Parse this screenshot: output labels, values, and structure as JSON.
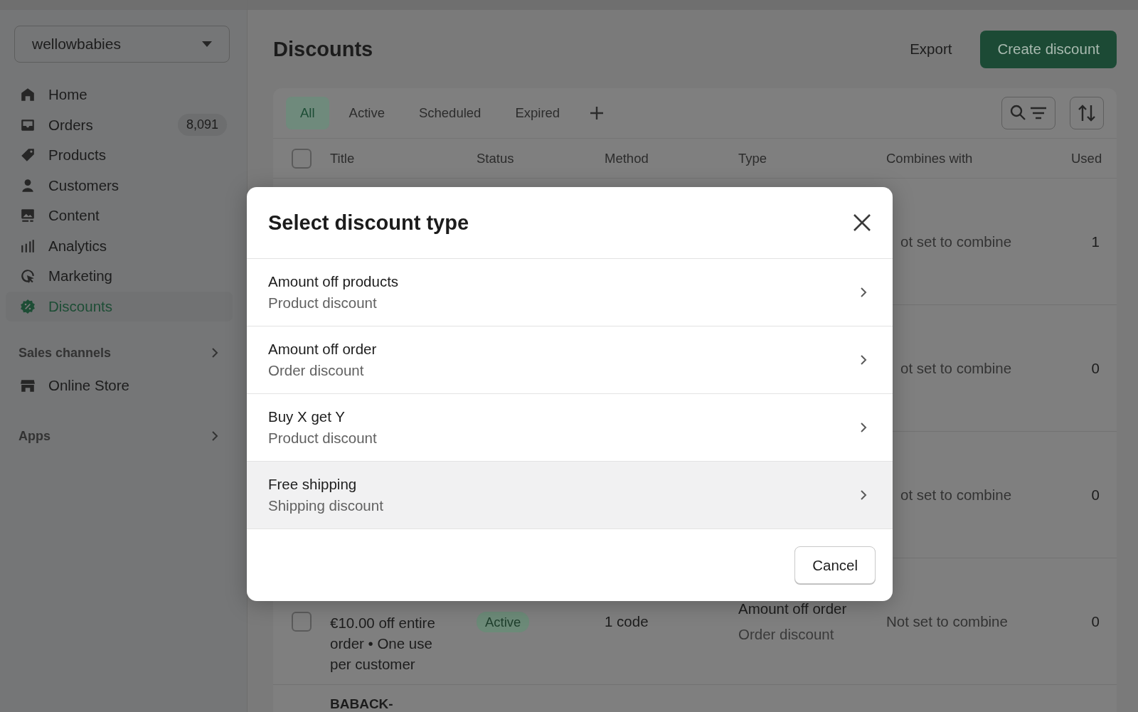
{
  "store_selector": {
    "value": "wellowbabies"
  },
  "sidebar": {
    "items": [
      {
        "label": "Home",
        "selected": false
      },
      {
        "label": "Orders",
        "badge": "8,091",
        "selected": false
      },
      {
        "label": "Products",
        "selected": false
      },
      {
        "label": "Customers",
        "selected": false
      },
      {
        "label": "Content",
        "selected": false
      },
      {
        "label": "Analytics",
        "selected": false
      },
      {
        "label": "Marketing",
        "selected": false
      },
      {
        "label": "Discounts",
        "selected": true
      }
    ],
    "sections": [
      {
        "heading": "Sales channels",
        "items": [
          {
            "label": "Online Store",
            "selected": false
          }
        ]
      },
      {
        "heading": "Apps"
      }
    ]
  },
  "page": {
    "title": "Discounts",
    "actions": [
      {
        "label": "Export",
        "kind": "plain"
      },
      {
        "label": "Create discount",
        "kind": "primary"
      }
    ]
  },
  "tabs": [
    {
      "label": "All",
      "selected": true
    },
    {
      "label": "Active",
      "selected": false
    },
    {
      "label": "Scheduled",
      "selected": false
    },
    {
      "label": "Expired",
      "selected": false
    }
  ],
  "table": {
    "select_all": {
      "checked": false
    },
    "columns": [
      "Title",
      "Status",
      "Method",
      "Type",
      "Combines with",
      "Used"
    ],
    "rows": [
      {
        "combines_with": "ot set to combine",
        "used": "1"
      },
      {
        "combines_with": "ot set to combine",
        "used": "0"
      },
      {
        "combines_with": "ot set to combine",
        "used": "0"
      },
      {
        "checked": false,
        "title": "€10.00 off entire order • One use per customer",
        "status": "Active",
        "method": "1 code",
        "type": "Amount off order",
        "type_detail": "Order discount",
        "combines_with": "Not set to combine",
        "used": "0"
      },
      {
        "title": "BABACK-"
      }
    ]
  },
  "modal": {
    "title": "Select discount type",
    "options": [
      {
        "title": "Amount off products",
        "subtitle": "Product discount",
        "selected": false
      },
      {
        "title": "Amount off order",
        "subtitle": "Order discount",
        "selected": false
      },
      {
        "title": "Buy X get Y",
        "subtitle": "Product discount",
        "selected": false
      },
      {
        "title": "Free shipping",
        "subtitle": "Shipping discount",
        "selected": true
      }
    ],
    "buttons": [
      "Cancel"
    ]
  }
}
